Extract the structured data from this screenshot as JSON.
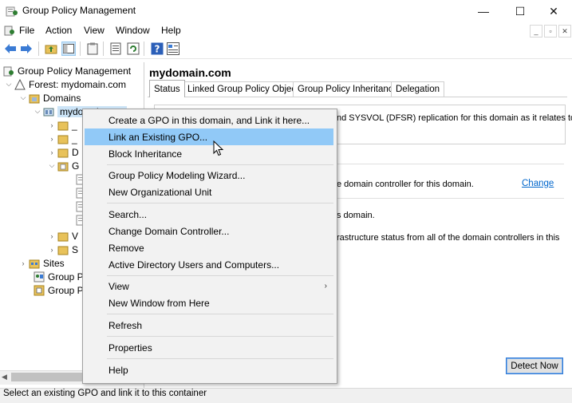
{
  "window": {
    "title": "Group Policy Management",
    "controls": {
      "minimize": "—",
      "maximize": "☐",
      "close": "✕"
    }
  },
  "menubar": {
    "items": [
      "File",
      "Action",
      "View",
      "Window",
      "Help"
    ],
    "mdi": {
      "minimize": "_",
      "restore": "▫",
      "close": "✕"
    }
  },
  "tree": {
    "root": "Group Policy Management",
    "forest": "Forest: mydomain.com",
    "domains": "Domains",
    "domain": "mydomain.com",
    "child_fragments": [
      "_",
      "_",
      "D",
      "G",
      "V",
      "S"
    ],
    "sites": "Sites",
    "group_frag_1": "Group P",
    "group_frag_2": "Group P"
  },
  "right": {
    "domain_title": "mydomain.com",
    "tabs": [
      "Status",
      "Linked Group Policy Objects",
      "Group Policy Inheritance",
      "Delegation"
    ],
    "lines": {
      "line1": "nd SYSVOL (DFSR) replication for this domain as it relates to",
      "line2": "e domain controller for this domain.",
      "line3": "s domain.",
      "line4": "rastructure status from all of the domain controllers in this"
    },
    "change_link": "Change",
    "detect_button": "Detect Now"
  },
  "context_menu": {
    "items": [
      "Create a GPO in this domain, and Link it here...",
      "Link an Existing GPO...",
      "Block Inheritance",
      "Group Policy Modeling Wizard...",
      "New Organizational Unit",
      "Search...",
      "Change Domain Controller...",
      "Remove",
      "Active Directory Users and Computers...",
      "View",
      "New Window from Here",
      "Refresh",
      "Properties",
      "Help"
    ],
    "highlighted": "Link an Existing GPO..."
  },
  "status": {
    "text": "Select an existing GPO and link it to this container"
  },
  "colors": {
    "highlight": "#91c9f7",
    "link": "#0066cc",
    "selection": "#cce4f7"
  }
}
